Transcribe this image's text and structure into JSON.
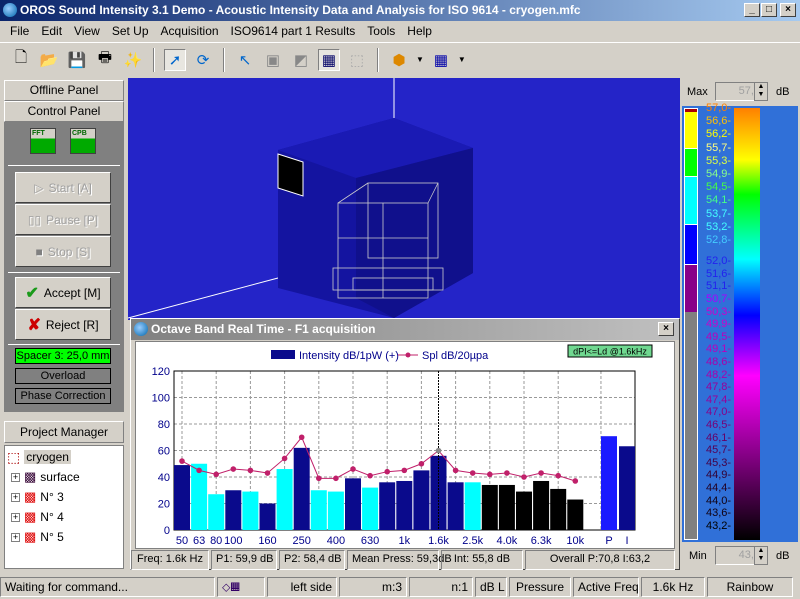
{
  "window": {
    "title": "OROS Sound Intensity 3.1 Demo - Acoustic Intensity Data and Analysis for ISO 9614 - cryogen.mfc"
  },
  "menu": [
    "File",
    "Edit",
    "View",
    "Set Up",
    "Acquisition",
    "ISO9614 part 1 Results",
    "Tools",
    "Help"
  ],
  "toolbar": {
    "icons": [
      "new-file-icon",
      "open-folder-icon",
      "save-icon",
      "print-icon",
      "wizard-icon",
      "pointer-icon",
      "rotate-icon",
      "probe-icon",
      "select-icon",
      "cursor-icon",
      "grid-select-icon",
      "wireframe-icon",
      "cube-color-icon",
      "grid-icon"
    ]
  },
  "left": {
    "offline_panel": "Offline Panel",
    "control_panel": "Control Panel",
    "fft": "FFT",
    "cpb": "CPB",
    "start": "Start [A]",
    "pause": "Pause [P]",
    "stop": "Stop [S]",
    "accept": "Accept [M]",
    "reject": "Reject [R]",
    "spacer": "Spacer 3: 25,0 mm",
    "overload": "Overload",
    "phase": "Phase Correction",
    "project_manager": "Project Manager",
    "tree": [
      {
        "label": "cryogen"
      },
      {
        "label": "surface"
      },
      {
        "label": "N° 3"
      },
      {
        "label": "N° 4"
      },
      {
        "label": "N° 5"
      }
    ]
  },
  "scale": {
    "max_label": "Max",
    "max_value": "57,0",
    "min_label": "Min",
    "min_value": "43,0",
    "unit": "dB",
    "ticks": [
      "57,0",
      "56,6",
      "56,2",
      "55,7",
      "55,3",
      "54,9",
      "54,5",
      "54,1",
      "53,7",
      "53,2",
      "52,8",
      "52,0",
      "51,6",
      "51,1",
      "50,7",
      "50,3",
      "49,9",
      "49,5",
      "49,1",
      "48,6",
      "48,2",
      "47,8",
      "47,4",
      "47,0",
      "46,5",
      "46,1",
      "45,7",
      "45,3",
      "44,9",
      "44,4",
      "44,0",
      "43,6",
      "43,2"
    ]
  },
  "chart_window": {
    "title": "Octave Band Real Time - F1 acquisition",
    "badge": "dPI<=Ld @1.6kHz",
    "status": [
      "Freq: 1.6k Hz",
      "P1: 59,9 dB",
      "P2: 58,4 dB",
      "Mean Press: 59,3dB",
      "Int: 55,8 dB",
      "Overall P:70,8  I:63,2"
    ]
  },
  "chart_data": {
    "type": "bar",
    "categories": [
      "50",
      "63",
      "80",
      "100",
      "125",
      "160",
      "200",
      "250",
      "315",
      "400",
      "500",
      "630",
      "800",
      "1k",
      "1.25k",
      "1.6k",
      "2k",
      "2.5k",
      "3.15k",
      "4.0k",
      "5k",
      "6.3k",
      "8k",
      "10k"
    ],
    "tick_labels": [
      "50",
      "63",
      "80",
      "100",
      "",
      "160",
      "",
      "250",
      "",
      "400",
      "",
      "630",
      "",
      "1k",
      "",
      "1.6k",
      "",
      "2.5k",
      "",
      "4.0k",
      "",
      "6.3k",
      "",
      "10k"
    ],
    "series": [
      {
        "name": "Intensity dB/1pW (+)",
        "type": "bar",
        "values": [
          49,
          50,
          27,
          30,
          29,
          20,
          46,
          62,
          30,
          29,
          39,
          32,
          36,
          37,
          45,
          56,
          36,
          36,
          34,
          34,
          29,
          37,
          31,
          23
        ],
        "colors": [
          "navy",
          "cyan",
          "cyan",
          "navy",
          "cyan",
          "navy",
          "cyan",
          "navy",
          "cyan",
          "cyan",
          "navy",
          "cyan",
          "navy",
          "navy",
          "navy",
          "navy",
          "navy",
          "cyan",
          "black",
          "black",
          "black",
          "black",
          "black",
          "black"
        ]
      },
      {
        "name": "Spl dB/20µpa",
        "type": "line",
        "values": [
          52,
          45,
          42,
          46,
          45,
          43,
          54,
          70,
          39,
          39,
          46,
          41,
          44,
          45,
          50,
          59.9,
          45,
          43,
          42,
          43,
          40,
          43,
          41,
          37
        ]
      }
    ],
    "overall": {
      "categories": [
        "P",
        "I"
      ],
      "values": [
        70.8,
        63.2
      ]
    },
    "ylim": [
      0,
      120
    ],
    "yticks": [
      0,
      20,
      40,
      60,
      80,
      100,
      120
    ],
    "grid": true,
    "cursor": "1.6k",
    "legend": "top",
    "colors": {
      "navy": "#0a0a8c",
      "cyan": "#00ffff",
      "black": "#000000",
      "line": "#c0206a",
      "P": "#1a1aff"
    }
  },
  "status": [
    "Waiting for command...",
    "left side",
    "m:3",
    "n:1",
    "dB L",
    "Pressure",
    "Active Freq",
    "1.6k Hz",
    "Rainbow"
  ]
}
